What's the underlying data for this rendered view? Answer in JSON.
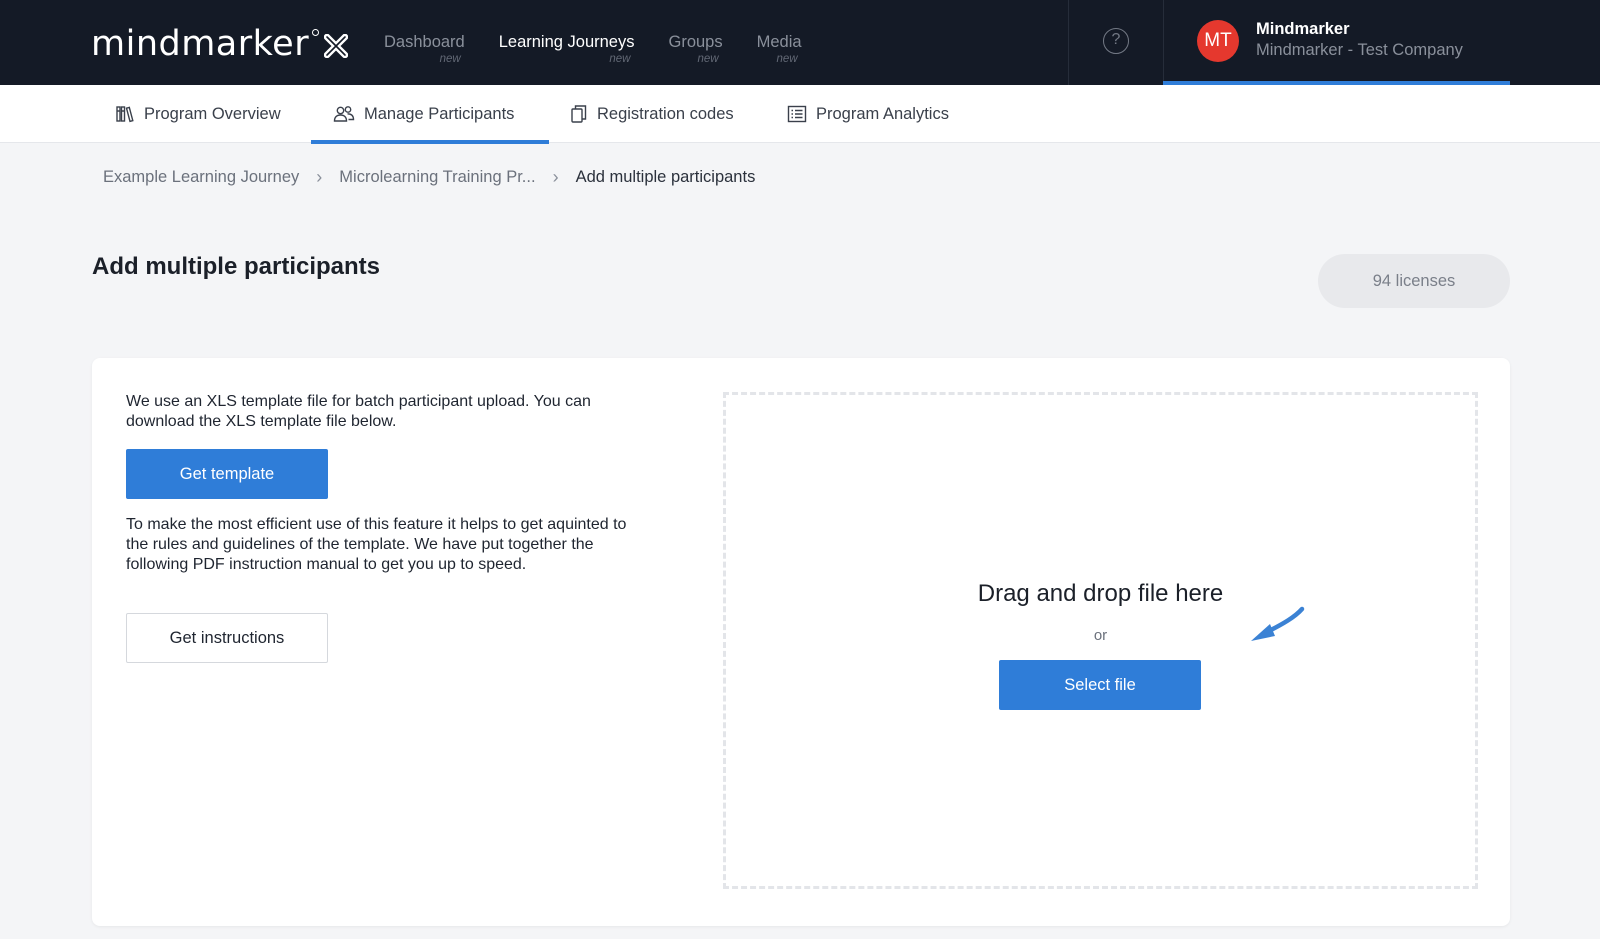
{
  "brand": {
    "logo_text": "mindmarker"
  },
  "nav": {
    "items": [
      {
        "label": "Dashboard",
        "badge": "new"
      },
      {
        "label": "Learning Journeys",
        "badge": "new"
      },
      {
        "label": "Groups",
        "badge": "new"
      },
      {
        "label": "Media",
        "badge": "new"
      }
    ]
  },
  "help": {
    "glyph": "?"
  },
  "account": {
    "initials": "MT",
    "name": "Mindmarker",
    "company": "Mindmarker - Test Company",
    "avatar_color": "#e5382e"
  },
  "subnav": {
    "tabs": [
      {
        "label": "Program Overview",
        "icon": "library-icon"
      },
      {
        "label": "Manage Participants",
        "icon": "users-icon"
      },
      {
        "label": "Registration codes",
        "icon": "copy-icon"
      },
      {
        "label": "Program Analytics",
        "icon": "list-icon"
      }
    ]
  },
  "breadcrumb": {
    "items": [
      "Example Learning Journey",
      "Microlearning Training Pr...",
      "Add multiple participants"
    ],
    "separator": "›"
  },
  "page": {
    "title": "Add multiple participants",
    "licenses": "94 licenses"
  },
  "upload": {
    "intro": "We use an XLS template file for batch participant upload. You can download the XLS template file below.",
    "get_template_label": "Get template",
    "guide": "To make the most efficient use of this feature it helps to get aquinted to the rules and guidelines of the template. We have put together the following PDF instruction manual to get you up to speed.",
    "get_instructions_label": "Get instructions",
    "drop_title": "Drag and drop file here",
    "drop_or": "or",
    "select_file_label": "Select file"
  },
  "colors": {
    "header_bg": "#141a26",
    "accent": "#2f7dd8",
    "page_bg": "#f4f5f7",
    "annotation_arrow": "#3b82d4"
  }
}
